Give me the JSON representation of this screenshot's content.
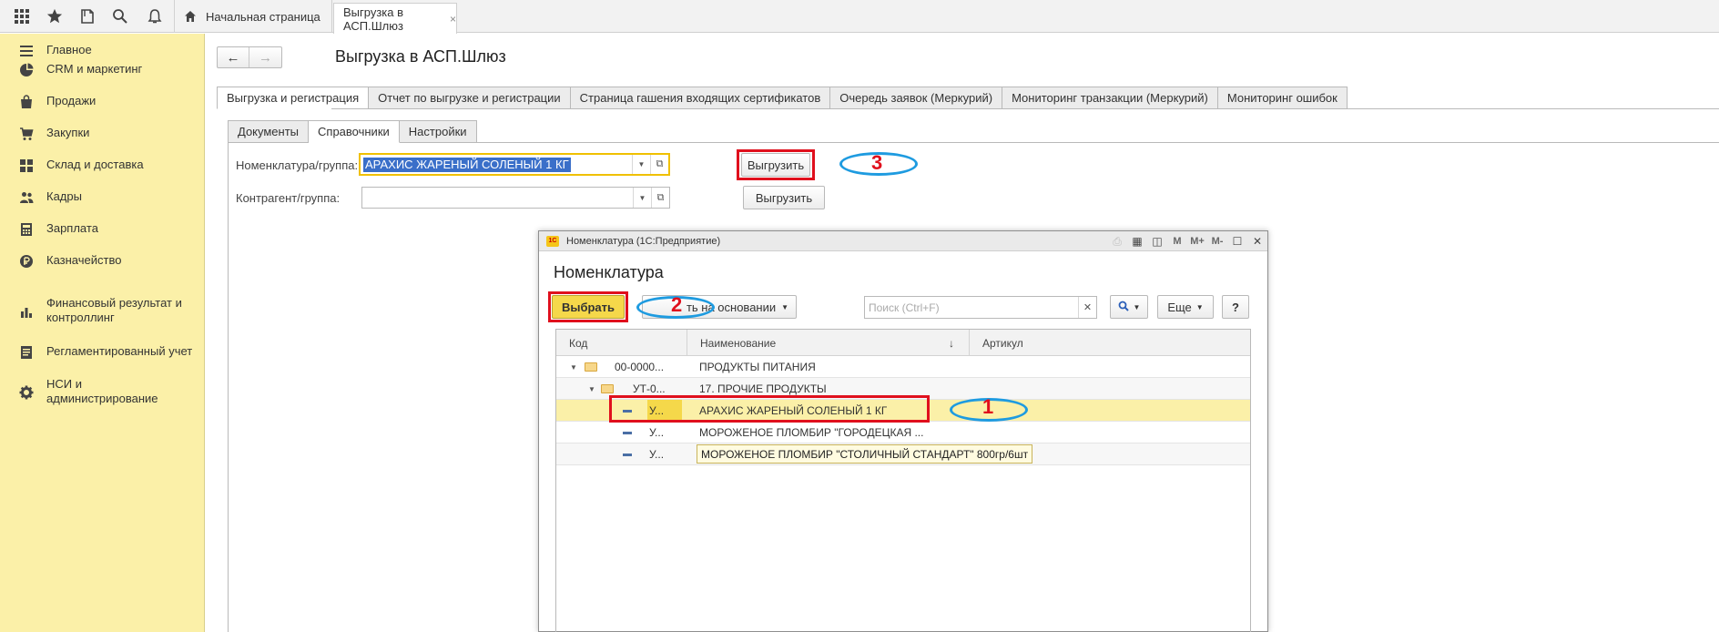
{
  "topbar": {
    "home_tab": "Начальная страница",
    "active_tab": "Выгрузка в АСП.Шлюз",
    "close_glyph": "×"
  },
  "sidebar": {
    "items": [
      {
        "label": "Главное",
        "icon": "menu-icon"
      },
      {
        "label": "CRM и маркетинг",
        "icon": "pie-chart-icon"
      },
      {
        "label": "Продажи",
        "icon": "bag-icon"
      },
      {
        "label": "Закупки",
        "icon": "cart-icon"
      },
      {
        "label": "Склад и доставка",
        "icon": "warehouse-icon"
      },
      {
        "label": "Кадры",
        "icon": "people-icon"
      },
      {
        "label": "Зарплата",
        "icon": "calculator-icon"
      },
      {
        "label": "Казначейство",
        "icon": "ruble-coin-icon"
      },
      {
        "label": "Финансовый результат и контроллинг",
        "icon": "bar-chart-icon"
      },
      {
        "label": "Регламентированный учет",
        "icon": "ledger-icon"
      },
      {
        "label": "НСИ и администрирование",
        "icon": "gear-icon"
      }
    ]
  },
  "main": {
    "title": "Выгрузка в АСП.Шлюз",
    "tabs": [
      "Выгрузка и регистрация",
      "Отчет по выгрузке и регистрации",
      "Страница гашения входящих сертификатов",
      "Очередь заявок (Меркурий)",
      "Мониторинг транзакции (Меркурий)",
      "Мониторинг ошибок"
    ],
    "subtabs": [
      "Документы",
      "Справочники",
      "Настройки"
    ],
    "nomenclature_label": "Номенклатура/группа:",
    "nomenclature_value": "АРАХИС ЖАРЕНЫЙ СОЛЕНЫЙ 1 КГ",
    "contractor_label": "Контрагент/группа:",
    "contractor_value": "",
    "export_button": "Выгрузить",
    "annotation_3": "3"
  },
  "dialog": {
    "window_title": "Номенклатура (1С:Предприятие)",
    "heading": "Номенклатура",
    "select_button": "Выбрать",
    "create_based_button": "ть на основании",
    "search_placeholder": "Поиск (Ctrl+F)",
    "more_button": "Еще",
    "help_button": "?",
    "annotation_1": "1",
    "annotation_2": "2",
    "columns": [
      "Код",
      "Наименование",
      "Артикул"
    ],
    "sort_glyph": "↓",
    "rows": [
      {
        "code": "00-0000...",
        "name": "ПРОДУКТЫ ПИТАНИЯ",
        "type": "folder"
      },
      {
        "code": "УТ-0...",
        "name": "17. ПРОЧИЕ ПРОДУКТЫ",
        "type": "folder"
      },
      {
        "code": "У...",
        "name": "АРАХИС ЖАРЕНЫЙ СОЛЕНЫЙ 1 КГ",
        "type": "item"
      },
      {
        "code": "У...",
        "name": "МОРОЖЕНОЕ ПЛОМБИР \"ГОРОДЕЦКАЯ ...",
        "type": "item"
      },
      {
        "code": "У...",
        "name": "",
        "type": "item"
      }
    ],
    "tooltip": "МОРОЖЕНОЕ ПЛОМБИР \"СТОЛИЧНЫЙ СТАНДАРТ\" 800гр/6шт"
  },
  "colors": {
    "sidebar_bg": "#fbf0a8",
    "annotation_red": "#e0101d",
    "annotation_blue": "#1e9be0",
    "selection_blue": "#3a6fc9",
    "focus_yellow": "#f0c000"
  }
}
